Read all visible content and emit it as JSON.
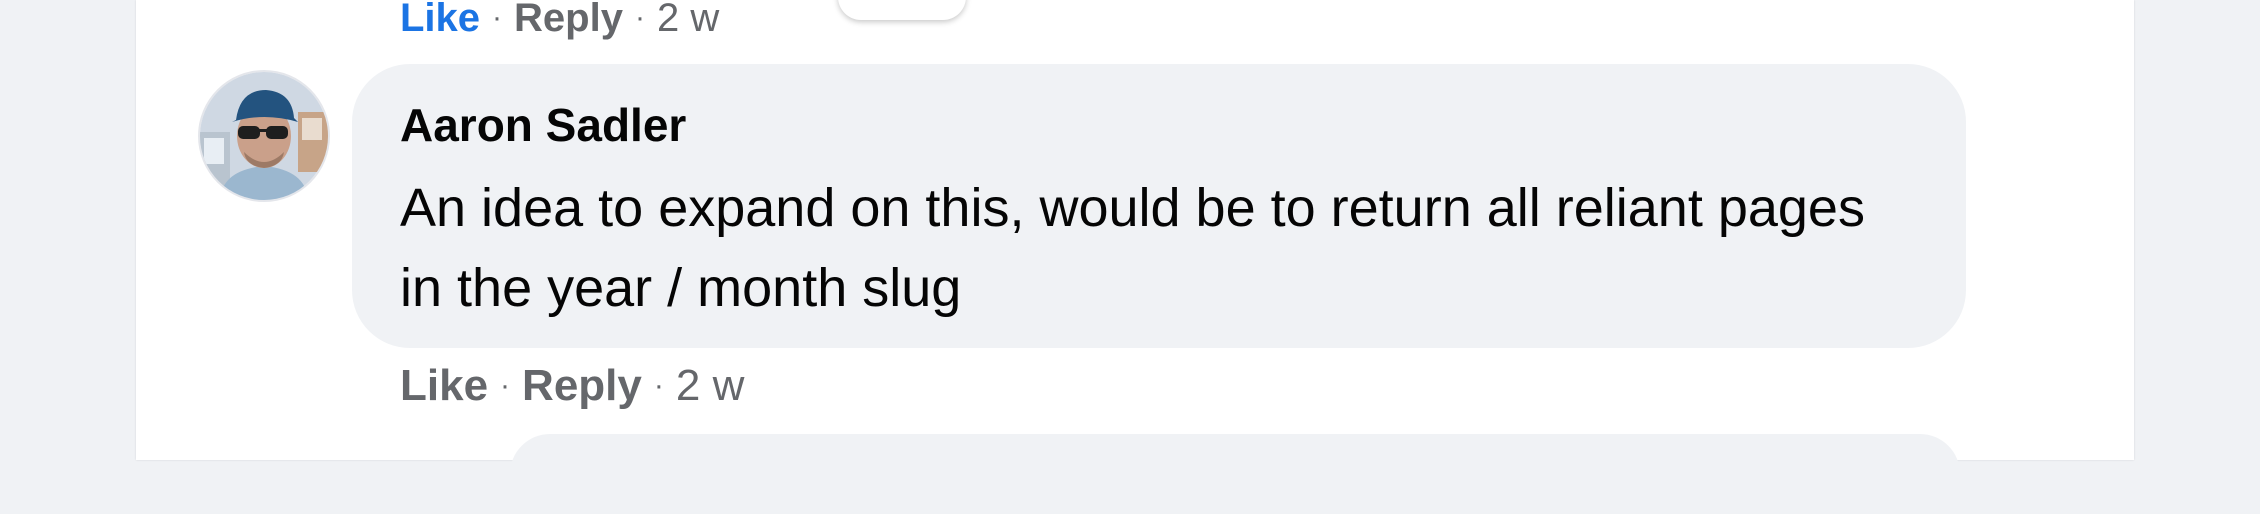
{
  "previous_comment": {
    "actions": {
      "like": "Like",
      "reply": "Reply",
      "separator": "·",
      "time": "2 w"
    }
  },
  "comment": {
    "author": "Aaron Sadler",
    "text": "An idea to expand on this, would be to return all reliant pages in the year / month slug",
    "actions": {
      "like": "Like",
      "reply": "Reply",
      "separator": "·",
      "time": "2 w"
    }
  },
  "colors": {
    "like_active": "#1b74e4",
    "action_text": "#65676b",
    "bubble_bg": "#f0f2f5",
    "page_bg": "#f0f2f5",
    "text": "#050505"
  }
}
